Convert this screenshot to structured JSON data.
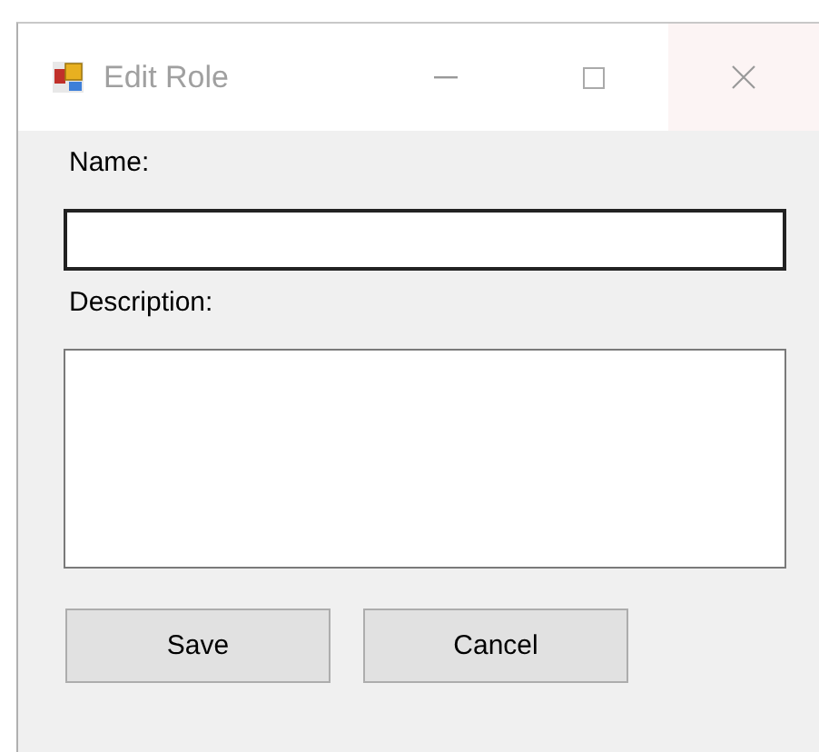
{
  "window": {
    "title": "Edit Role"
  },
  "fields": [
    {
      "label": "Name:",
      "kind": "line"
    },
    {
      "label": "Description:",
      "kind": "multiline"
    }
  ],
  "buttons": [
    "Save",
    "Cancel"
  ]
}
